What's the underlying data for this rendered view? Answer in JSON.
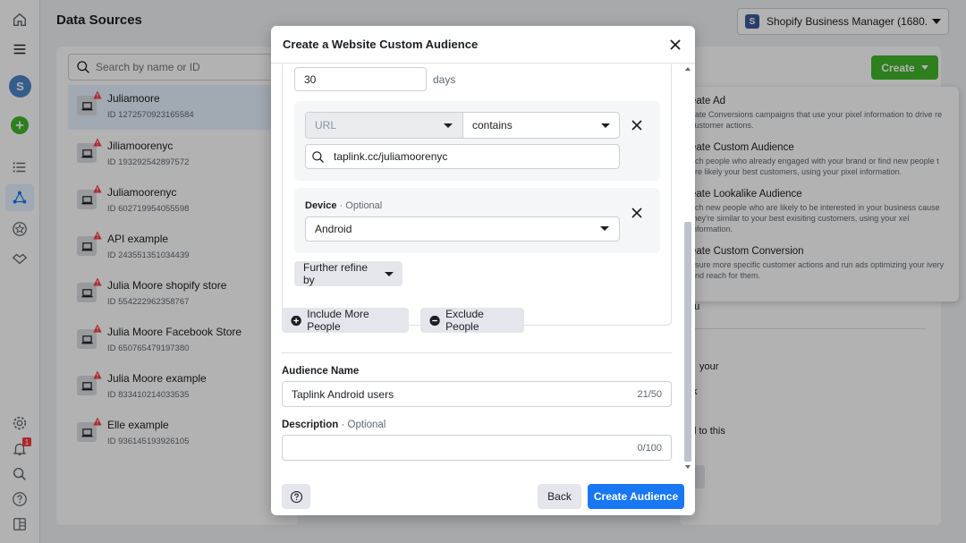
{
  "page": {
    "title": "Data Sources"
  },
  "rail": {
    "avatar_letter": "S",
    "notification_count": "1"
  },
  "business": {
    "letter": "S",
    "name": "Shopify Business Manager (1680..."
  },
  "sources": {
    "search_placeholder": "Search by name or ID",
    "items": [
      {
        "name": "Juliamoore",
        "id": "ID 1272570923165584"
      },
      {
        "name": "Jiliamoorenyc",
        "id": "ID 193292542897572"
      },
      {
        "name": "Juliamoorenyc",
        "id": "ID 602719954055598"
      },
      {
        "name": "API example",
        "id": "ID 243551351034439"
      },
      {
        "name": "Julia Moore shopify store",
        "id": "ID 554222962358767"
      },
      {
        "name": "Julia Moore Facebook Store",
        "id": "ID 650765479197380"
      },
      {
        "name": "Julia Moore example",
        "id": "ID 833410214033535"
      },
      {
        "name": "Elle example",
        "id": "ID 936145193926105"
      }
    ]
  },
  "create_button": {
    "label": "Create"
  },
  "create_menu": [
    {
      "title": "eate Ad",
      "desc": "eate Conversions campaigns that use your pixel information to drive re customer actions."
    },
    {
      "title": "eate Custom Audience",
      "desc": "ach people who already engaged with your brand or find new people t are likely your best customers, using your pixel information."
    },
    {
      "title": "eate Lookalike Audience",
      "desc": "ach new people who are likely to be interested in your business cause they're similar to your best exisiting customers, using your xel information."
    },
    {
      "title": "eate Custom Conversion",
      "desc": "asure more specific customer actions and run ads optimizing your ivery and reach for them."
    }
  ],
  "behind_text": {
    "a": "ou",
    "b": "your",
    "c": "k",
    "d": "l to this"
  },
  "modal": {
    "title": "Create a Website Custom Audience",
    "days_value": "30",
    "days_label": "days",
    "rule": {
      "field": "URL",
      "operator": "contains",
      "value": "taplink.cc/juliamoorenyc"
    },
    "device": {
      "label": "Device",
      "optional": "· Optional",
      "value": "Android"
    },
    "refine_label": "Further refine by",
    "include_label": "Include More People",
    "exclude_label": "Exclude People",
    "audience_name_label": "Audience Name",
    "audience_name_value": "Taplink Android users",
    "audience_name_count": "21/50",
    "description_label": "Description",
    "description_optional": "· Optional",
    "description_count": "0/100",
    "back_label": "Back",
    "create_label": "Create Audience"
  },
  "colors": {
    "primary": "#1877f2",
    "green": "#42b72a",
    "error": "#fa383e"
  }
}
